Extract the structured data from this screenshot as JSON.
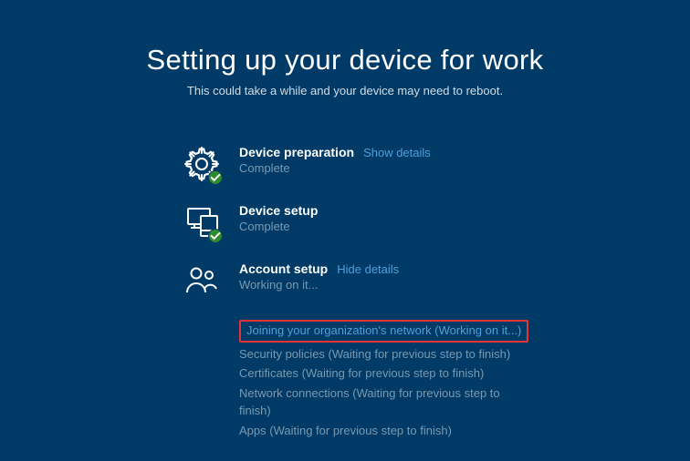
{
  "header": {
    "title": "Setting up your device for work",
    "subtitle": "This could take a while and your device may need to reboot."
  },
  "sections": {
    "device_preparation": {
      "title": "Device preparation",
      "details_link": "Show details",
      "status": "Complete"
    },
    "device_setup": {
      "title": "Device setup",
      "status": "Complete"
    },
    "account_setup": {
      "title": "Account setup",
      "details_link": "Hide details",
      "status": "Working on it...",
      "substeps": [
        "Joining your organization's network (Working on it...)",
        "Security policies (Waiting for previous step to finish)",
        "Certificates (Waiting for previous step to finish)",
        "Network connections (Waiting for previous step to finish)",
        "Apps (Waiting for previous step to finish)"
      ]
    }
  },
  "colors": {
    "background": "#003a66",
    "link": "#4fa0d8",
    "muted": "#7a99b0",
    "highlight_border": "#e43434",
    "success_badge": "#2e8b2e"
  }
}
